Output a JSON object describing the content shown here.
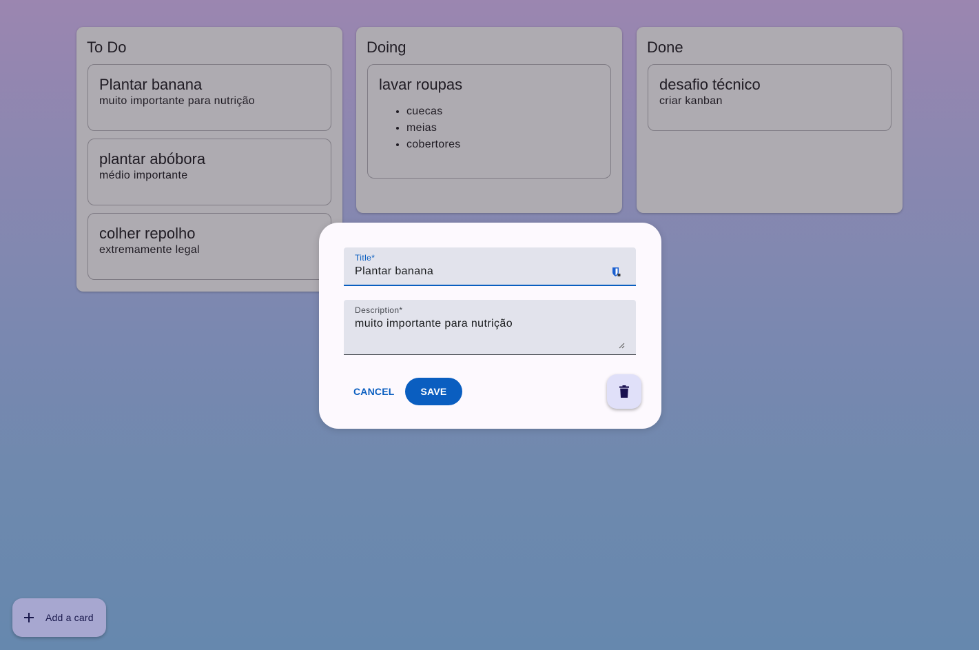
{
  "columns": [
    {
      "title": "To Do",
      "cards": [
        {
          "title": "Plantar banana",
          "description": "muito importante para nutrição"
        },
        {
          "title": "plantar abóbora",
          "description": "médio importante"
        },
        {
          "title": "colher repolho",
          "description": "extremamente legal"
        }
      ]
    },
    {
      "title": "Doing",
      "cards": [
        {
          "title": "lavar roupas",
          "items": [
            "cuecas",
            "meias",
            "cobertores"
          ]
        }
      ]
    },
    {
      "title": "Done",
      "cards": [
        {
          "title": "desafio técnico",
          "description": "criar kanban"
        }
      ]
    }
  ],
  "dialog": {
    "title_label": "Title*",
    "title_value": "Plantar banana",
    "description_label": "Description*",
    "description_value": "muito importante para nutrição",
    "cancel_label": "CANCEL",
    "save_label": "SAVE",
    "delete_icon": "trash-icon"
  },
  "fab": {
    "label": "Add a card",
    "icon": "plus-icon"
  },
  "colors": {
    "primary": "#0a5ec0",
    "column_bg": "#aeabb1",
    "dialog_bg": "#fdf9fe",
    "fab_bg": "#a7a7d0",
    "delete_bg": "#e0e0f9"
  }
}
